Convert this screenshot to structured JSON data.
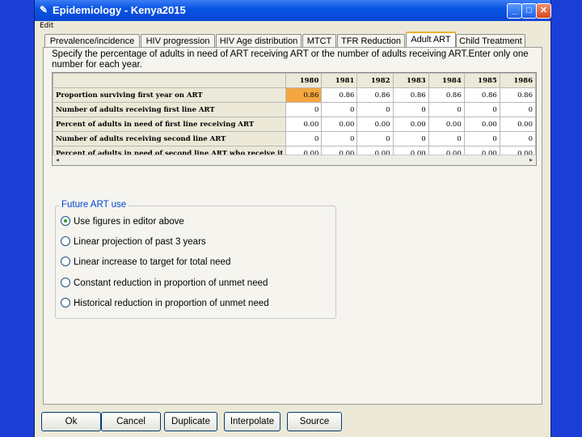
{
  "window": {
    "title": "Epidemiology - Kenya2015",
    "edit_label": "Edit"
  },
  "tabs": [
    {
      "label": "Prevalence/incidence",
      "active": false
    },
    {
      "label": "HIV progression",
      "active": false
    },
    {
      "label": "HIV Age distribution",
      "active": false
    },
    {
      "label": "MTCT",
      "active": false
    },
    {
      "label": "TFR Reduction",
      "active": false
    },
    {
      "label": "Adult ART",
      "active": true
    },
    {
      "label": "Child Treatment",
      "active": false
    }
  ],
  "instructions": "Specify the percentage of adults in need of ART receiving ART or the number of adults receiving ART.Enter only one number for each year.",
  "grid": {
    "years": [
      "1980",
      "1981",
      "1982",
      "1983",
      "1984",
      "1985",
      "1986"
    ],
    "rows": [
      {
        "label": "Proportion surviving first year on ART",
        "values": [
          "0.86",
          "0.86",
          "0.86",
          "0.86",
          "0.86",
          "0.86",
          "0.86"
        ]
      },
      {
        "label": "Number of adults receiving first line ART",
        "values": [
          "0",
          "0",
          "0",
          "0",
          "0",
          "0",
          "0"
        ]
      },
      {
        "label": "Percent of adults in need of first line receiving ART",
        "values": [
          "0.00",
          "0.00",
          "0.00",
          "0.00",
          "0.00",
          "0.00",
          "0.00"
        ]
      },
      {
        "label": "Number of adults receiving second line ART",
        "values": [
          "0",
          "0",
          "0",
          "0",
          "0",
          "0",
          "0"
        ]
      },
      {
        "label": "Percent of adults in need of second line ART who receive it",
        "values": [
          "0.00",
          "0.00",
          "0.00",
          "0.00",
          "0.00",
          "0.00",
          "0.00"
        ]
      }
    ]
  },
  "future": {
    "title": "Future ART use",
    "options": [
      {
        "label": "Use figures in editor above",
        "checked": true
      },
      {
        "label": "Linear projection of past 3 years",
        "checked": false
      },
      {
        "label": "Linear increase to target for total need",
        "checked": false
      },
      {
        "label": "Constant reduction in proportion of unmet need",
        "checked": false
      },
      {
        "label": "Historical reduction in proportion of unmet need",
        "checked": false
      }
    ]
  },
  "buttons": {
    "ok": "Ok",
    "cancel": "Cancel",
    "duplicate": "Duplicate",
    "interpolate": "Interpolate",
    "source": "Source"
  },
  "colors": {
    "desktop": "#1b3fd6",
    "selection": "#f4a640",
    "group_title": "#0046d5"
  }
}
